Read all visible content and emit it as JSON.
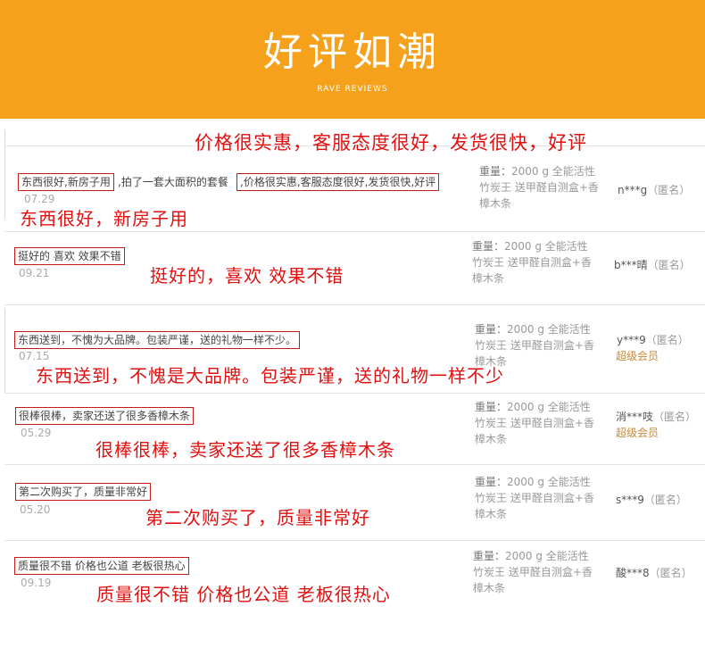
{
  "banner": {
    "title": "好评如潮",
    "subtitle": "RAVE REVIEWS"
  },
  "spec": {
    "weight_label": "重量：",
    "weight_value": "2000 g 全能活性",
    "line2": "竹炭王 送甲醛自测盒+香",
    "line3": "樟木条"
  },
  "reviews": [
    {
      "content": "东西很好,新房子用",
      "content_tail": ",拍了一套大面积的套餐",
      "content_extra": ",价格很实惠,客服态度很好,发货很快,好评",
      "date": "07.29",
      "user": "n***g",
      "anon": "（匿名）",
      "annotation_top": "价格很实惠，客服态度很好，发货很快，好评",
      "annotation": "东西很好，新房子用"
    },
    {
      "content": "挺好的 喜欢 效果不错",
      "date": "09.21",
      "user": "b***晴",
      "anon": "（匿名）",
      "annotation": "挺好的，喜欢 效果不错"
    },
    {
      "content": "东西送到，不愧为大品牌。包装严谨，送的礼物一样不少。",
      "date": "07.15",
      "user": "y***9",
      "anon": "（匿名）",
      "badge": "超级会员",
      "annotation": "东西送到，不愧是大品牌。包装严谨，送的礼物一样不少"
    },
    {
      "content": "很棒很棒，卖家还送了很多香樟木条",
      "date": "05.29",
      "user": "消***吱",
      "anon": "（匿名）",
      "badge": "超级会员",
      "annotation": "很棒很棒，卖家还送了很多香樟木条"
    },
    {
      "content": "第二次购买了，质量非常好",
      "date": "05.20",
      "user": "s***9",
      "anon": "（匿名）",
      "annotation": "第二次购买了，质量非常好"
    },
    {
      "content": "质量很不错 价格也公道 老板很热心",
      "date": "09.19",
      "user": "酸***8",
      "anon": "（匿名）",
      "annotation": "质量很不错 价格也公道 老板很热心"
    }
  ]
}
